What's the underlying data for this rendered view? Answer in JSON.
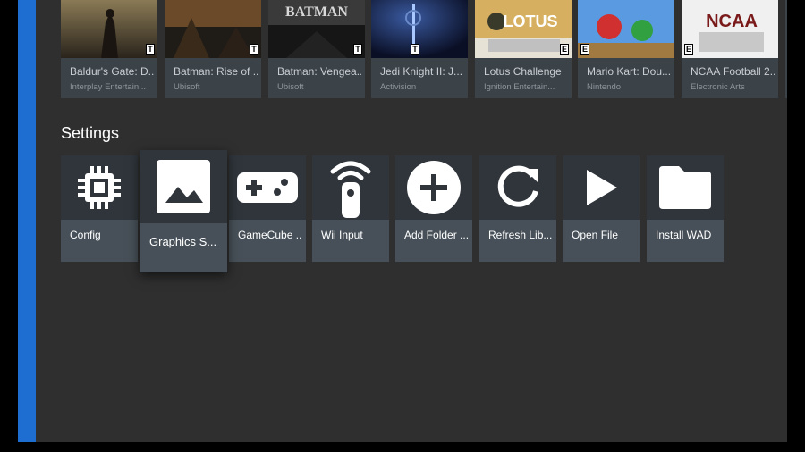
{
  "games": [
    {
      "title": "Baldur's Gate: D...",
      "publisher": "Interplay Entertain...",
      "rating": "T",
      "cover": "baldurs-gate-cover",
      "colors": [
        "#7a6a4a",
        "#2a241c"
      ]
    },
    {
      "title": "Batman: Rise of ...",
      "publisher": "Ubisoft",
      "rating": "T",
      "cover": "batman-rise-cover",
      "colors": [
        "#8a5a2a",
        "#1c1a18"
      ]
    },
    {
      "title": "Batman: Vengea...",
      "publisher": "Ubisoft",
      "rating": "T",
      "cover": "batman-vengeance-cover",
      "cover_text": "BATMAN",
      "colors": [
        "#4a4a4a",
        "#111111"
      ]
    },
    {
      "title": "Jedi Knight II: J...",
      "publisher": "Activision",
      "rating": "T",
      "cover": "jedi-knight-cover",
      "colors": [
        "#1c2a5a",
        "#0a0f25"
      ]
    },
    {
      "title": "Lotus Challenge",
      "publisher": "Ignition Entertain...",
      "rating": "E",
      "cover": "lotus-challenge-cover",
      "cover_text": "LOTUS",
      "colors": [
        "#c9a040",
        "#e0e0e0"
      ]
    },
    {
      "title": "Mario Kart: Dou...",
      "publisher": "Nintendo",
      "rating": "E",
      "cover": "mario-kart-cover",
      "colors": [
        "#3a7ad0",
        "#c83030"
      ]
    },
    {
      "title": "NCAA Football 2...",
      "publisher": "Electronic Arts",
      "rating": "E",
      "cover": "ncaa-football-cover",
      "cover_text": "NCAA",
      "colors": [
        "#e8e8e8",
        "#7a1a1a"
      ]
    }
  ],
  "settings": {
    "heading": "Settings",
    "tiles": [
      {
        "label": "Config",
        "icon": "chip-icon"
      },
      {
        "label": "Graphics S...",
        "icon": "image-icon",
        "focused": true
      },
      {
        "label": "GameCube ...",
        "icon": "gamepad-icon"
      },
      {
        "label": "Wii Input",
        "icon": "wii-remote-icon"
      },
      {
        "label": "Add Folder ...",
        "icon": "add-circle-icon"
      },
      {
        "label": "Refresh Lib...",
        "icon": "refresh-icon"
      },
      {
        "label": "Open File",
        "icon": "play-icon"
      },
      {
        "label": "Install WAD",
        "icon": "folder-icon"
      }
    ]
  },
  "colors": {
    "accent": "#1e6ed2",
    "background": "#2f2f2f",
    "tile": "#475058"
  }
}
